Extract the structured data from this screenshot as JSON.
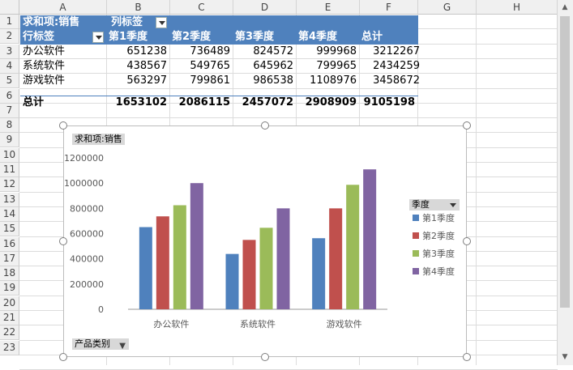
{
  "columns": [
    "A",
    "B",
    "C",
    "D",
    "E",
    "F",
    "G",
    "H"
  ],
  "rows": [
    "1",
    "2",
    "3",
    "4",
    "5",
    "6",
    "7",
    "8",
    "9",
    "10",
    "11",
    "12",
    "13",
    "14",
    "15",
    "16",
    "17",
    "18",
    "19",
    "20",
    "21",
    "22",
    "23"
  ],
  "pivot": {
    "row1_label": "求和项:销售",
    "row1_collabel": "列标签",
    "row_label": "行标签",
    "headers": [
      "第1季度",
      "第2季度",
      "第3季度",
      "第4季度",
      "总计"
    ],
    "data": [
      {
        "name": "办公软件",
        "values": [
          "651238",
          "736489",
          "824572",
          "999968",
          "3212267"
        ]
      },
      {
        "name": "系统软件",
        "values": [
          "438567",
          "549765",
          "645962",
          "799965",
          "2434259"
        ]
      },
      {
        "name": "游戏软件",
        "values": [
          "563297",
          "799861",
          "986538",
          "1108976",
          "3458672"
        ]
      }
    ],
    "total": {
      "name": "总计",
      "values": [
        "1653102",
        "2086115",
        "2457072",
        "2908909",
        "9105198"
      ]
    }
  },
  "chart_field_button": "求和项:销售",
  "axis_field_button": "产品类别",
  "legend_field_button": "季度",
  "chart_data": {
    "type": "bar",
    "categories": [
      "办公软件",
      "系统软件",
      "游戏软件"
    ],
    "series": [
      {
        "name": "第1季度",
        "values": [
          651238,
          438567,
          563297
        ]
      },
      {
        "name": "第2季度",
        "values": [
          736489,
          549765,
          799861
        ]
      },
      {
        "name": "第3季度",
        "values": [
          824572,
          645962,
          986538
        ]
      },
      {
        "name": "第4季度",
        "values": [
          999968,
          799965,
          1108976
        ]
      }
    ],
    "colors": [
      "#4f81bd",
      "#c0504d",
      "#9bbb59",
      "#8064a2"
    ],
    "yticks": [
      "0",
      "200000",
      "400000",
      "600000",
      "800000",
      "1000000",
      "1200000"
    ],
    "ylim": [
      0,
      1200000
    ],
    "legend_position": "right"
  }
}
